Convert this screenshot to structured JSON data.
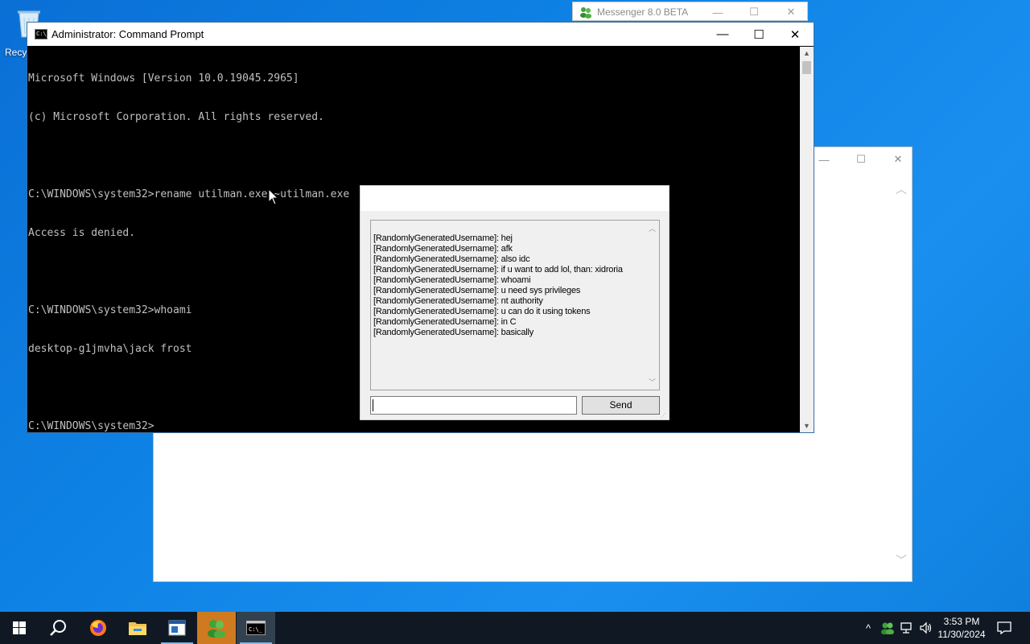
{
  "desktop": {
    "icons": [
      {
        "label": "Recy",
        "icon": "recycle-bin-icon"
      }
    ]
  },
  "messenger_window": {
    "title": "Messenger 8.0 BETA",
    "controls": {
      "minimize": "—",
      "maximize": "☐",
      "close": "✕"
    }
  },
  "background_window": {
    "controls": {
      "minimize": "—",
      "maximize": "☐",
      "close": "✕"
    },
    "scroll_up": "︿",
    "scroll_down": "﹀"
  },
  "cmd_window": {
    "title": "Administrator: Command Prompt",
    "icon_text": "C:\\_",
    "controls": {
      "minimize": "—",
      "maximize": "☐",
      "close": "✕"
    },
    "lines": [
      "Microsoft Windows [Version 10.0.19045.2965]",
      "(c) Microsoft Corporation. All rights reserved.",
      "",
      "C:\\WINDOWS\\system32>rename utilman.exe ~utilman.exe",
      "Access is denied.",
      "",
      "C:\\WINDOWS\\system32>whoami",
      "desktop-g1jmvha\\jack frost",
      "",
      "C:\\WINDOWS\\system32>"
    ],
    "scroll_up": "▲",
    "scroll_down": "▼"
  },
  "chat_dialog": {
    "messages": [
      "[RandomlyGeneratedUsername]: hej",
      "[RandomlyGeneratedUsername]: afk",
      "[RandomlyGeneratedUsername]: also idc",
      "[RandomlyGeneratedUsername]: if u want to add lol, than: xidroria",
      "[RandomlyGeneratedUsername]: whoami",
      "[RandomlyGeneratedUsername]: u need sys privileges",
      "[RandomlyGeneratedUsername]: nt authority",
      "[RandomlyGeneratedUsername]: u can do it using tokens",
      "[RandomlyGeneratedUsername]: in C",
      "[RandomlyGeneratedUsername]: basically"
    ],
    "input_value": "",
    "send_label": "Send",
    "scroll_up": "︿",
    "scroll_down": "﹀"
  },
  "taskbar": {
    "start_icon": "windows-logo-icon",
    "search_icon": "search-icon",
    "apps": [
      {
        "name": "firefox-icon",
        "state": "normal"
      },
      {
        "name": "file-explorer-icon",
        "state": "normal"
      },
      {
        "name": "window-app-icon",
        "state": "running"
      },
      {
        "name": "messenger-icon",
        "state": "highlighted"
      },
      {
        "name": "command-prompt-icon",
        "state": "active"
      }
    ],
    "tray": {
      "chevron": "^",
      "icons": [
        "messenger-tray-icon",
        "network-icon",
        "volume-icon"
      ],
      "time": "3:53 PM",
      "date": "11/30/2024",
      "notification_icon": "notification-icon"
    }
  },
  "colors": {
    "desktop_bg": "#0f84e6",
    "taskbar_bg": "#101923",
    "console_text": "#c0c0c0",
    "messenger_orange": "#cf7a21"
  }
}
